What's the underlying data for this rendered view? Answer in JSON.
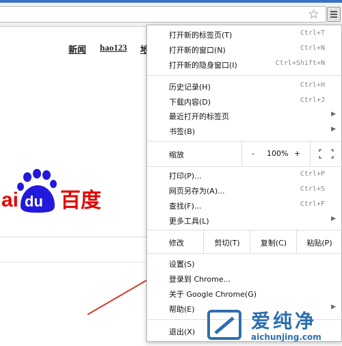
{
  "toolbar": {
    "star_icon": "star-icon",
    "menu_icon": "hamburger-menu-icon"
  },
  "page": {
    "nav_links": [
      "新闻",
      "hao123",
      "地"
    ],
    "logo": {
      "text_left": "ai",
      "text_du": "du",
      "text_cn": "百度",
      "colors": {
        "red": "#e10601",
        "blue": "#2319dc"
      }
    }
  },
  "menu": {
    "group1": [
      {
        "label": "打开新的标签页(T)",
        "shortcut": "Ctrl+T"
      },
      {
        "label": "打开新的窗口(N)",
        "shortcut": "Ctrl+N"
      },
      {
        "label": "打开新的隐身窗口(I)",
        "shortcut": "Ctrl+Shift+N"
      }
    ],
    "group2": [
      {
        "label": "历史记录(H)",
        "shortcut": "Ctrl+H"
      },
      {
        "label": "下载内容(D)",
        "shortcut": "Ctrl+J"
      },
      {
        "label": "最近打开的标签页",
        "shortcut": "",
        "arrow": "▶"
      },
      {
        "label": "书签(B)",
        "shortcut": "",
        "arrow": "▶"
      }
    ],
    "zoom": {
      "label": "缩放",
      "minus": "-",
      "value": "100%",
      "plus": "+"
    },
    "group3": [
      {
        "label": "打印(P)...",
        "shortcut": "Ctrl+P"
      },
      {
        "label": "网页另存为(A)...",
        "shortcut": "Ctrl+S"
      },
      {
        "label": "查找(F)...",
        "shortcut": "Ctrl+F"
      },
      {
        "label": "更多工具(L)",
        "shortcut": "",
        "arrow": "▶"
      }
    ],
    "edit": {
      "label": "修改",
      "cut": "剪切(T)",
      "copy": "复制(C)",
      "paste": "粘贴(P)"
    },
    "group4": [
      {
        "label": "设置(S)"
      },
      {
        "label": "登录到 Chrome..."
      },
      {
        "label": "关于 Google Chrome(G)"
      },
      {
        "label": "帮助(E)",
        "arrow": "▶"
      }
    ],
    "exit": {
      "label": "退出(X)"
    }
  },
  "watermark": {
    "title": "爱纯净",
    "url": "aichunjing.com",
    "color": "#2d6fb0"
  },
  "annotation": {
    "arrow_color": "#d23a2e"
  }
}
